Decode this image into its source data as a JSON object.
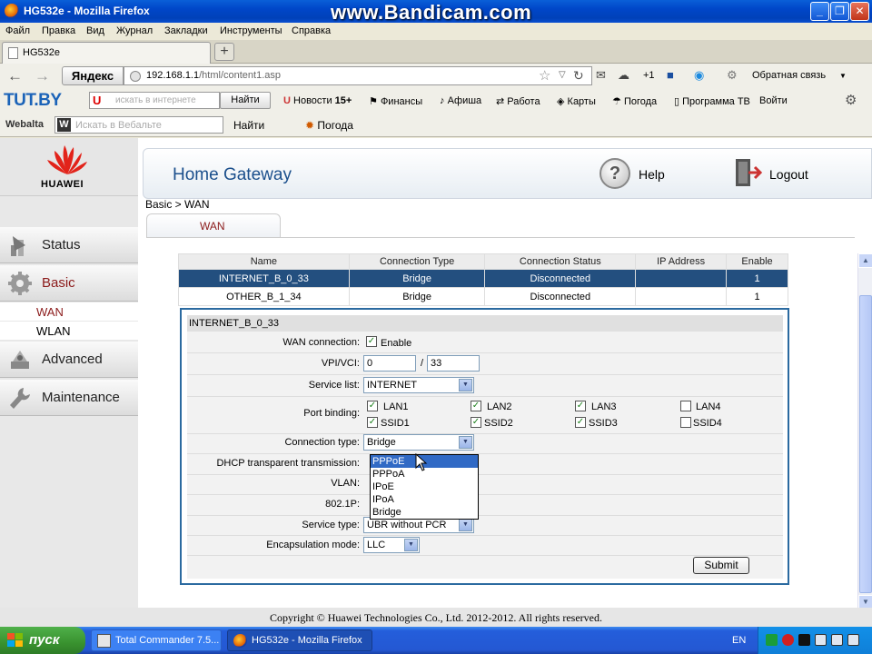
{
  "window": {
    "title": "HG532e - Mozilla Firefox",
    "watermark": "www.Bandicam.com",
    "minimize": "_",
    "restore": "❐",
    "close": "✕"
  },
  "menu": [
    "Файл",
    "Правка",
    "Вид",
    "Журнал",
    "Закладки",
    "Инструменты",
    "Справка"
  ],
  "tabs": [
    {
      "label": "HG532e"
    }
  ],
  "new_tab": "+",
  "nav": {
    "back": "←",
    "forward": "→",
    "yandex_logo": "Яндекс",
    "url_host": "192.168.1.1",
    "url_path": "/html/content1.asp",
    "cloud_count": "+1",
    "feedback": "Обратная связь"
  },
  "tutbar": {
    "logo": "TUT.BY",
    "search_placeholder": "искать в интернете",
    "find_button": "Найти",
    "links": [
      {
        "label": "Новости",
        "badge": "15+"
      },
      {
        "label": "Финансы"
      },
      {
        "label": "Афиша"
      },
      {
        "label": "Работа"
      },
      {
        "label": "Карты"
      },
      {
        "label": "Погода"
      },
      {
        "label": "Программа ТВ"
      },
      {
        "label": "Войти"
      }
    ]
  },
  "webalta": {
    "logo": "Webalta",
    "search_placeholder": "Искать в Вебальте",
    "find_button": "Найти",
    "weather": "Погода"
  },
  "sidebar": {
    "logo": "HUAWEI",
    "items": [
      {
        "label": "Status"
      },
      {
        "label": "Basic"
      },
      {
        "label": "Advanced"
      },
      {
        "label": "Maintenance"
      }
    ],
    "subitems": [
      {
        "label": "WAN"
      },
      {
        "label": "WLAN"
      }
    ]
  },
  "header": {
    "title": "Home Gateway",
    "help": "Help",
    "logout": "Logout"
  },
  "breadcrumb": "Basic > WAN",
  "subtab": "WAN",
  "wan_table": {
    "columns": [
      "Name",
      "Connection Type",
      "Connection Status",
      "IP Address",
      "Enable"
    ],
    "rows": [
      {
        "name": "INTERNET_B_0_33",
        "type": "Bridge",
        "status": "Disconnected",
        "ip": "",
        "enable": "1",
        "selected": true
      },
      {
        "name": "OTHER_B_1_34",
        "type": "Bridge",
        "status": "Disconnected",
        "ip": "",
        "enable": "1",
        "selected": false
      }
    ]
  },
  "form": {
    "title": "INTERNET_B_0_33",
    "wan_connection_label": "WAN connection:",
    "enable_label": "Enable",
    "vpivci_label": "VPI/VCI:",
    "vpi": "0",
    "slash": "/",
    "vci": "33",
    "service_list_label": "Service list:",
    "service_list_value": "INTERNET",
    "port_binding_label": "Port binding:",
    "ports": [
      {
        "label": "LAN1",
        "checked": true
      },
      {
        "label": "LAN2",
        "checked": true
      },
      {
        "label": "LAN3",
        "checked": true
      },
      {
        "label": "LAN4",
        "checked": false
      },
      {
        "label": "SSID1",
        "checked": true
      },
      {
        "label": "SSID2",
        "checked": true
      },
      {
        "label": "SSID3",
        "checked": true
      },
      {
        "label": "SSID4",
        "checked": false
      }
    ],
    "connection_type_label": "Connection type:",
    "connection_type_value": "Bridge",
    "connection_type_options": [
      "PPPoE",
      "PPPoA",
      "IPoE",
      "IPoA",
      "Bridge"
    ],
    "highlighted_option": "PPPoE",
    "dhcp_label": "DHCP transparent transmission:",
    "vlan_label": "VLAN:",
    "p8021_label": "802.1P:",
    "service_type_label": "Service type:",
    "service_type_value": "UBR without PCR",
    "encap_label": "Encapsulation mode:",
    "encap_value": "LLC",
    "submit": "Submit"
  },
  "footer": {
    "copyright": "Copyright © Huawei Technologies Co., Ltd. 2012-2012. All rights reserved."
  },
  "taskbar": {
    "start": "пуск",
    "items": [
      {
        "label": "Total Commander 7.5..."
      },
      {
        "label": "HG532e - Mozilla Firefox"
      }
    ],
    "lang": "EN"
  },
  "colors": {
    "accent": "#234f7f",
    "panel_border": "#2b6aa0",
    "basic_text": "#8b1a1a",
    "huawei_red": "#e2231a"
  }
}
